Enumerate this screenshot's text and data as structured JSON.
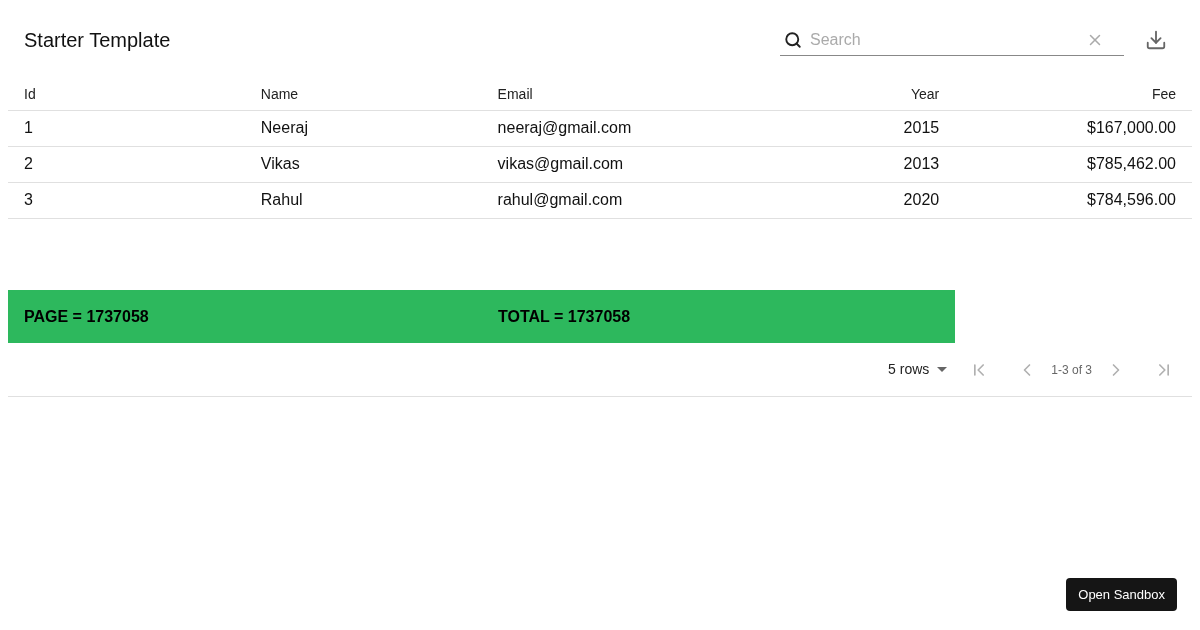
{
  "title": "Starter Template",
  "search": {
    "placeholder": "Search"
  },
  "table": {
    "columns": [
      {
        "label": "Id",
        "numeric": false
      },
      {
        "label": "Name",
        "numeric": false
      },
      {
        "label": "Email",
        "numeric": false
      },
      {
        "label": "Year",
        "numeric": true
      },
      {
        "label": "Fee",
        "numeric": true
      }
    ],
    "rows": [
      [
        "1",
        "Neeraj",
        "neeraj@gmail.com",
        "2015",
        "$167,000.00"
      ],
      [
        "2",
        "Vikas",
        "vikas@gmail.com",
        "2013",
        "$785,462.00"
      ],
      [
        "3",
        "Rahul",
        "rahul@gmail.com",
        "2020",
        "$784,596.00"
      ]
    ]
  },
  "summary": {
    "page": "PAGE = 1737058",
    "total": "TOTAL = 1737058"
  },
  "pagination": {
    "rows_per_page": "5 rows",
    "range": "1-3 of 3",
    "first_disabled": true,
    "prev_disabled": true,
    "next_disabled": true,
    "last_disabled": true
  },
  "sandbox_button": "Open Sandbox"
}
